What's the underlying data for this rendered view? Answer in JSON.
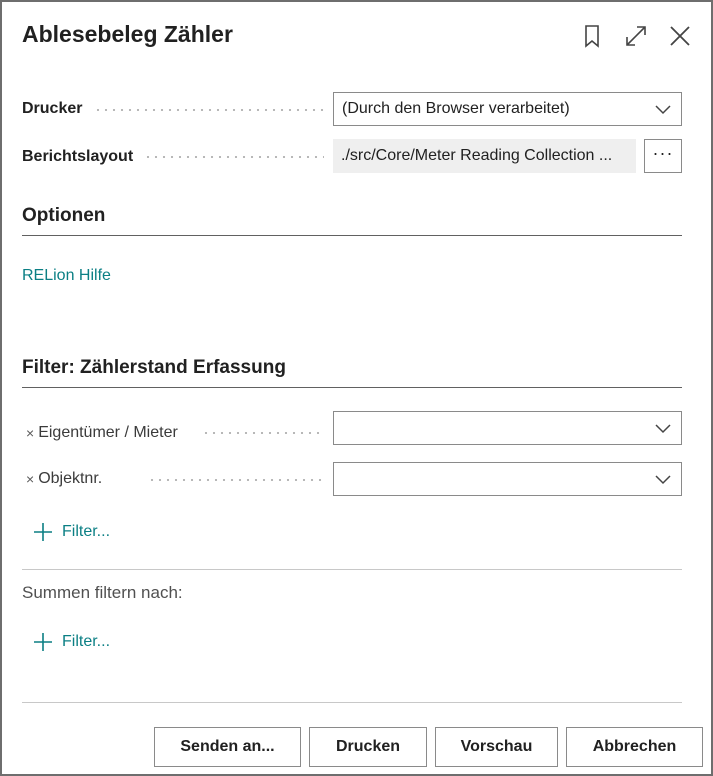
{
  "dialog": {
    "title": "Ablesebeleg Zähler"
  },
  "printer": {
    "label": "Drucker",
    "value": "(Durch den Browser verarbeitet)"
  },
  "layout": {
    "label": "Berichtslayout",
    "value": "./src/Core/Meter Reading Collection ...",
    "button": "···"
  },
  "options": {
    "title": "Optionen",
    "help_link": "RELion Hilfe"
  },
  "filter": {
    "title": "Filter: Zählerstand Erfassung",
    "fields": [
      {
        "label": "Eigentümer / Mieter",
        "value": ""
      },
      {
        "label": "Objektnr.",
        "value": ""
      }
    ],
    "add_label": "Filter...",
    "remove_glyph": "×"
  },
  "totals": {
    "title": "Summen filtern nach:",
    "add_label": "Filter..."
  },
  "buttons": {
    "send": "Senden an...",
    "print": "Drucken",
    "preview": "Vorschau",
    "cancel": "Abbrechen"
  },
  "colors": {
    "link": "#0b7f84",
    "border": "#6e6e6e"
  }
}
